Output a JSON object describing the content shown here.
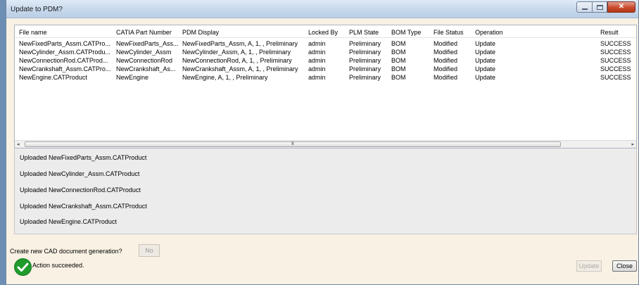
{
  "window": {
    "title": "Update to PDM?"
  },
  "table": {
    "columns": [
      "File name",
      "CATIA Part Number",
      "PDM Display",
      "Locked By",
      "PLM State",
      "BOM Type",
      "File Status",
      "Operation",
      "Result"
    ],
    "rows": [
      [
        "NewFixedParts_Assm.CATPro...",
        "NewFixedParts_Ass...",
        "NewFixedParts_Assm, A, 1, , Preliminary",
        "admin",
        "Preliminary",
        "BOM",
        "Modified",
        "Update",
        "SUCCESS"
      ],
      [
        "NewCylinder_Assm.CATProdu...",
        "NewCylinder_Assm",
        "NewCylinder_Assm, A, 1, , Preliminary",
        "admin",
        "Preliminary",
        "BOM",
        "Modified",
        "Update",
        "SUCCESS"
      ],
      [
        "NewConnectionRod.CATProd...",
        "NewConnectionRod",
        "NewConnectionRod, A, 1, , Preliminary",
        "admin",
        "Preliminary",
        "BOM",
        "Modified",
        "Update",
        "SUCCESS"
      ],
      [
        "NewCrankshaft_Assm.CATPro...",
        "NewCrankshaft_As...",
        "NewCrankshaft_Assm, A, 1, , Preliminary",
        "admin",
        "Preliminary",
        "BOM",
        "Modified",
        "Update",
        "SUCCESS"
      ],
      [
        "NewEngine.CATProduct",
        "NewEngine",
        "NewEngine, A, 1, , Preliminary",
        "admin",
        "Preliminary",
        "BOM",
        "Modified",
        "Update",
        "SUCCESS"
      ]
    ]
  },
  "scrollbar": {
    "left_arrow": "◂",
    "right_arrow": "▸",
    "grip": "III"
  },
  "log": [
    "Uploaded NewFixedParts_Assm.CATProduct",
    "Uploaded NewCylinder_Assm.CATProduct",
    "Uploaded NewConnectionRod.CATProduct",
    "Uploaded NewCrankshaft_Assm.CATProduct",
    "Uploaded NewEngine.CATProduct"
  ],
  "cad_prompt": {
    "label": "Create new CAD document generation?",
    "button": "No"
  },
  "status": {
    "text": "Action succeeded.",
    "icon": "check-circle-icon",
    "color": "#1f9c2c"
  },
  "buttons": {
    "update": "Update",
    "close": "Close"
  }
}
